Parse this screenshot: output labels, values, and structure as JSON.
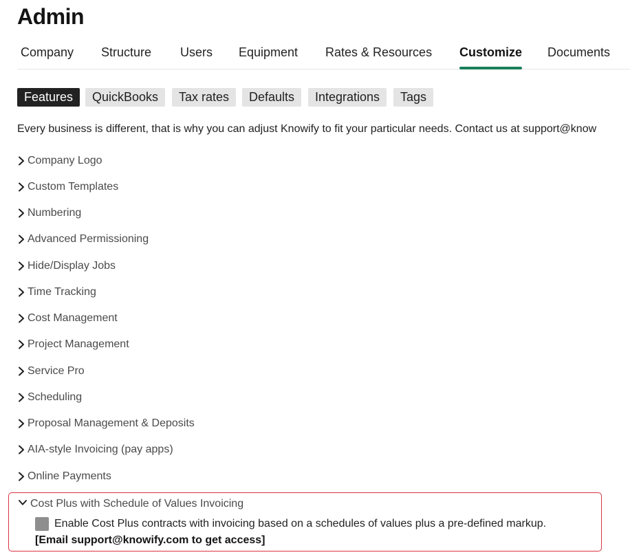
{
  "page": {
    "title": "Admin"
  },
  "main_tabs": [
    {
      "label": "Company"
    },
    {
      "label": "Structure"
    },
    {
      "label": "Users"
    },
    {
      "label": "Equipment"
    },
    {
      "label": "Rates & Resources"
    },
    {
      "label": "Customize",
      "active": true
    },
    {
      "label": "Documents"
    }
  ],
  "sub_tabs": [
    {
      "label": "Features",
      "active": true
    },
    {
      "label": "QuickBooks"
    },
    {
      "label": "Tax rates"
    },
    {
      "label": "Defaults"
    },
    {
      "label": "Integrations"
    },
    {
      "label": "Tags"
    }
  ],
  "intro": "Every business is different, that is why you can adjust Knowify to fit your particular needs. Contact us at support@know",
  "features": [
    {
      "label": "Company Logo",
      "icon": "chevron-right-icon"
    },
    {
      "label": "Custom Templates",
      "icon": "chevron-right-icon"
    },
    {
      "label": "Numbering",
      "icon": "chevron-right-icon"
    },
    {
      "label": "Advanced Permissioning",
      "icon": "chevron-right-icon"
    },
    {
      "label": "Hide/Display Jobs",
      "icon": "chevron-right-icon"
    },
    {
      "label": "Time Tracking",
      "icon": "chevron-right-icon"
    },
    {
      "label": "Cost Management",
      "icon": "chevron-right-icon"
    },
    {
      "label": "Project Management",
      "icon": "chevron-right-icon"
    },
    {
      "label": "Service Pro",
      "icon": "chevron-right-icon"
    },
    {
      "label": "Scheduling",
      "icon": "chevron-right-icon"
    },
    {
      "label": "Proposal Management & Deposits",
      "icon": "chevron-right-icon"
    },
    {
      "label": "AIA-style Invoicing (pay apps)",
      "icon": "chevron-right-icon"
    },
    {
      "label": "Online Payments",
      "icon": "chevron-right-icon"
    }
  ],
  "expanded_feature": {
    "label": "Cost Plus with Schedule of Values Invoicing",
    "icon": "chevron-down-icon",
    "option_label": "Enable Cost Plus contracts with invoicing based on a schedules of values plus a pre-defined markup.",
    "option_checked": false,
    "access_note": "[Email support@knowify.com to get access]"
  },
  "colors": {
    "accent": "#1a7f5a",
    "highlight_border": "#d9333f",
    "active_subtab_bg": "#222222",
    "subtab_bg": "#e4e4e4",
    "checkbox": "#8e8e8e"
  }
}
